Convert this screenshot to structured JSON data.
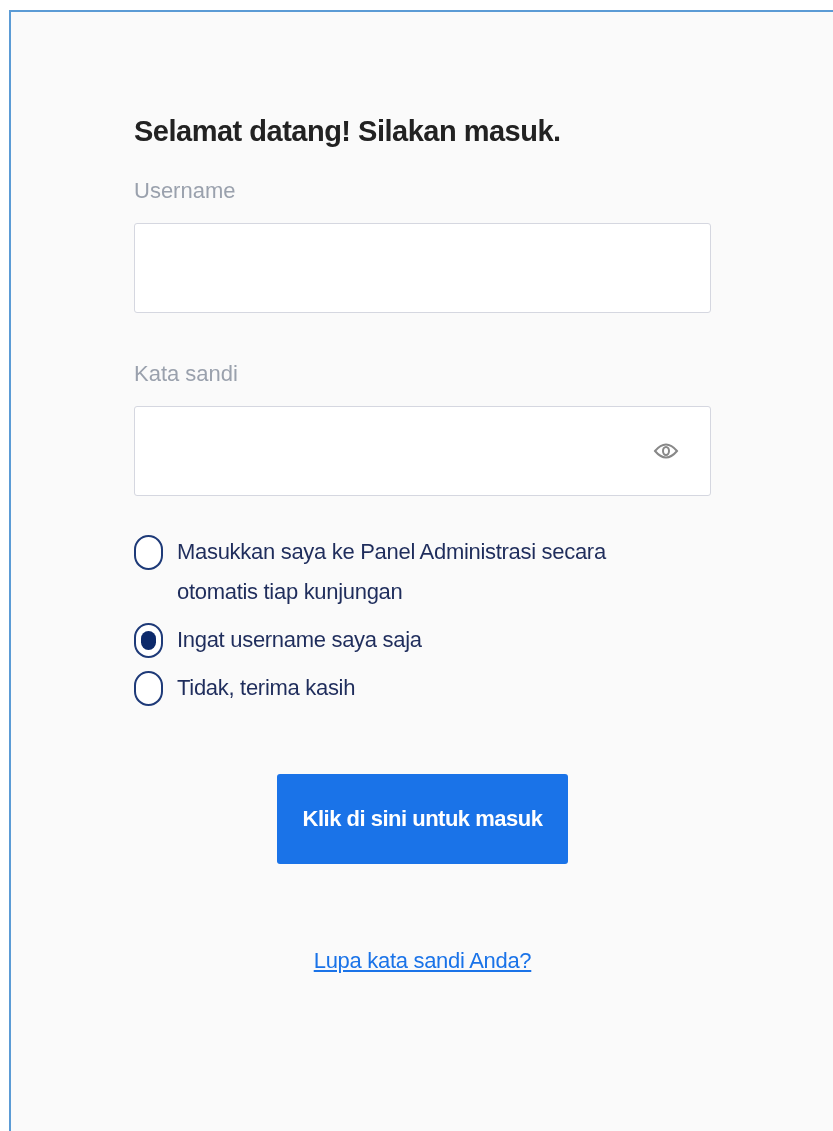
{
  "title": "Selamat datang! Silakan masuk.",
  "username": {
    "label": "Username"
  },
  "password": {
    "label": "Kata sandi"
  },
  "options": [
    {
      "label": "Masukkan saya ke Panel Administrasi secara otomatis tiap kunjungan",
      "selected": false
    },
    {
      "label": "Ingat username saya saja",
      "selected": true
    },
    {
      "label": "Tidak, terima kasih",
      "selected": false
    }
  ],
  "submit": "Klik di sini untuk masuk",
  "forgot_link": "Lupa kata sandi Anda?"
}
